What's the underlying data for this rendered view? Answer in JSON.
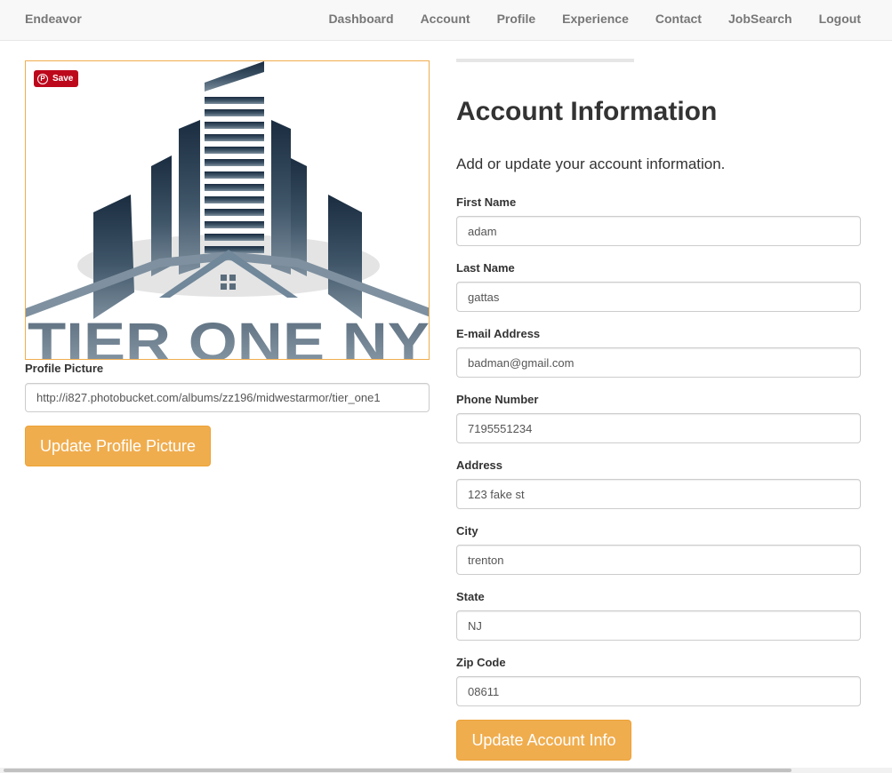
{
  "navbar": {
    "brand": "Endeavor",
    "links": [
      "Dashboard",
      "Account",
      "Profile",
      "Experience",
      "Contact",
      "JobSearch",
      "Logout"
    ]
  },
  "profile_image": {
    "logo_text": "TIER ONE NY",
    "pin_save_label": "Save",
    "pin_icon_glyph": "P"
  },
  "profile_picture": {
    "label": "Profile Picture",
    "url_value": "http://i827.photobucket.com/albums/zz196/midwestarmor/tier_one1",
    "button_label": "Update Profile Picture"
  },
  "account": {
    "title": "Account Information",
    "subtitle": "Add or update your account information.",
    "fields": [
      {
        "label": "First Name",
        "value": "adam"
      },
      {
        "label": "Last Name",
        "value": "gattas"
      },
      {
        "label": "E-mail Address",
        "value": "badman@gmail.com"
      },
      {
        "label": "Phone Number",
        "value": "7195551234"
      },
      {
        "label": "Address",
        "value": "123 fake st"
      },
      {
        "label": "City",
        "value": "trenton"
      },
      {
        "label": "State",
        "value": "NJ"
      },
      {
        "label": "Zip Code",
        "value": "08611"
      }
    ],
    "button_label": "Update Account Info"
  },
  "colors": {
    "accent": "#f0ad4e",
    "pinterest": "#bd081c",
    "logo_dark": "#1f3449",
    "logo_mid": "#6f8394"
  }
}
